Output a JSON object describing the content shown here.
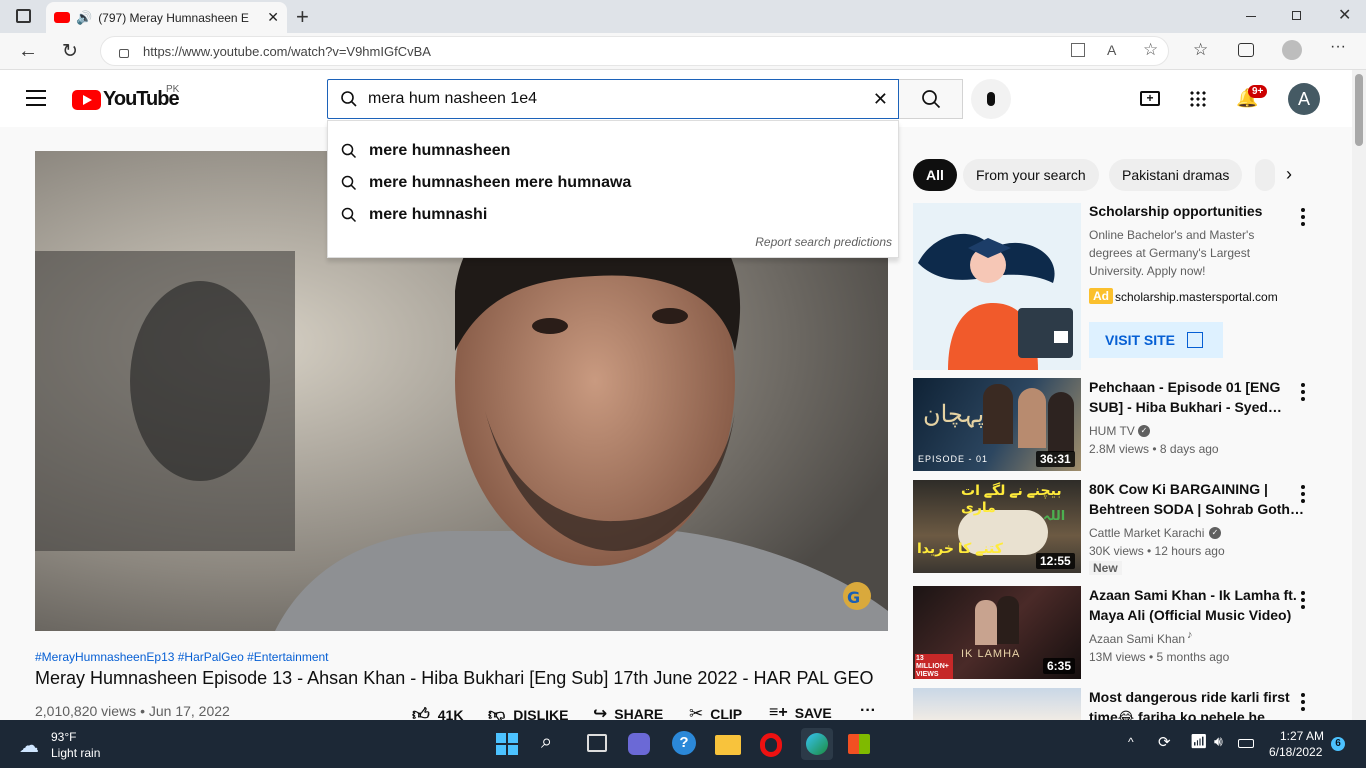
{
  "browser": {
    "tab_title": "(797) Meray Humnasheen E",
    "url": "https://www.youtube.com/watch?v=V9hmIGfCvBA"
  },
  "header": {
    "logo_text": "YouTube",
    "region": "PK",
    "search_value": "mera hum nasheen 1e4",
    "notification_count": "9+",
    "avatar_letter": "A"
  },
  "suggestions": {
    "items": [
      "mere humnasheen",
      "mere humnasheen mere humnawa",
      "mere humnashi"
    ],
    "report": "Report search predictions"
  },
  "video": {
    "hashtags": "#MerayHumnasheenEp13 #HarPalGeo #Entertainment",
    "title": "Meray Humnasheen Episode 13 - Ahsan Khan - Hiba Bukhari [Eng Sub] 17th June 2022 - HAR PAL GEO",
    "views_date": "2,010,820 views • Jun 17, 2022",
    "likes": "41K",
    "dislike": "DISLIKE",
    "share": "SHARE",
    "clip": "CLIP",
    "save": "SAVE"
  },
  "chips": [
    "All",
    "From your search",
    "Pakistani dramas"
  ],
  "ad": {
    "title": "Scholarship opportunities",
    "description": "Online Bachelor's and Master's degrees at Germany's Largest University. Apply now!",
    "badge": "Ad",
    "domain": "scholarship.mastersportal.com",
    "cta": "VISIT SITE"
  },
  "recommendations": [
    {
      "title_line1": "Pehchaan - Episode 01 [ENG",
      "title_line2": "SUB] - Hiba Bukhari - Syed…",
      "channel": "HUM TV",
      "meta": "2.8M views • 8 days ago",
      "duration": "36:31",
      "thumb_text": "EPISODE - 01"
    },
    {
      "title_line1": "80K Cow Ki BARGAINING |",
      "title_line2": "Behtreen SODA | Sohrab Goth…",
      "channel": "Cattle Market Karachi",
      "meta": "30K views • 12 hours ago",
      "duration": "12:55",
      "badge": "New"
    },
    {
      "title_line1": "Azaan Sami Khan - Ik Lamha ft.",
      "title_line2": "Maya Ali (Official Music Video)",
      "channel": "Azaan Sami Khan",
      "meta": "13M views • 5 months ago",
      "duration": "6:35",
      "thumb_text": "IK LAMHA",
      "thumb_badge": "13 MILLION+ VIEWS"
    },
    {
      "title_line1": "Most dangerous ride karli first",
      "title_line2": "time😂 fariha ko pehele he"
    }
  ],
  "taskbar": {
    "temp": "93°F",
    "weather": "Light rain",
    "time": "1:27 AM",
    "date": "6/18/2022",
    "notif": "6"
  }
}
